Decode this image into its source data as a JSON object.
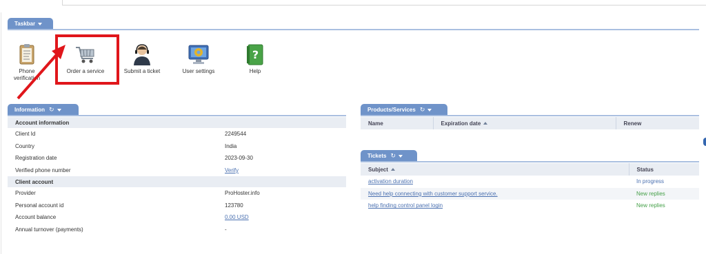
{
  "taskbar": {
    "title": "Taskbar",
    "items": [
      {
        "label": "Phone verification",
        "icon": "clipboard-icon"
      },
      {
        "label": "Order a service",
        "icon": "shopping-cart-icon"
      },
      {
        "label": "Submit a ticket",
        "icon": "support-agent-icon"
      },
      {
        "label": "User settings",
        "icon": "monitor-gear-icon"
      },
      {
        "label": "Help",
        "icon": "help-book-icon"
      }
    ]
  },
  "information": {
    "title": "Information",
    "account_section": "Account information",
    "client_section": "Client account",
    "rows": [
      {
        "label": "Client Id",
        "value": "2249544"
      },
      {
        "label": "Country",
        "value": "India"
      },
      {
        "label": "Registration date",
        "value": "2023-09-30"
      },
      {
        "label": "Verified phone number",
        "value": "Verify"
      },
      {
        "label": "Provider",
        "value": "ProHoster.info"
      },
      {
        "label": "Personal account id",
        "value": "123780"
      },
      {
        "label": "Account balance",
        "value": "0.00 USD"
      },
      {
        "label": "Annual turnover (payments)",
        "value": "-"
      }
    ]
  },
  "products": {
    "title": "Products/Services",
    "columns": [
      "Name",
      "Expiration date",
      "Renew"
    ]
  },
  "tickets": {
    "title": "Tickets",
    "columns": [
      "Subject",
      "Status"
    ],
    "rows": [
      {
        "subject": "activation duration",
        "status": "In progress"
      },
      {
        "subject": "Need help connecting with customer support service.",
        "status": "New replies"
      },
      {
        "subject": "help finding control panel login",
        "status": "New replies"
      }
    ]
  },
  "colors": {
    "tab": "#6f93c9",
    "highlight": "#e0161b",
    "link": "#4a70b0",
    "status_green": "#46a049"
  }
}
